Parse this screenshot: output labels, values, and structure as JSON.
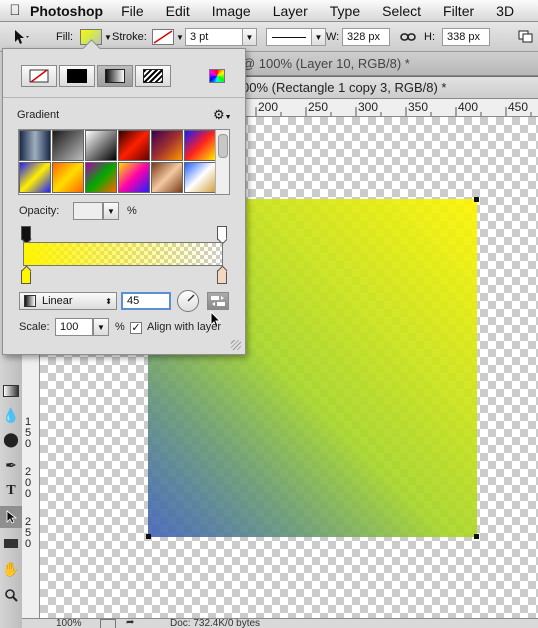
{
  "menubar": {
    "app_name": "Photoshop",
    "items": [
      "File",
      "Edit",
      "Image",
      "Layer",
      "Type",
      "Select",
      "Filter",
      "3D"
    ]
  },
  "options_bar": {
    "fill_label": "Fill:",
    "stroke_label": "Stroke:",
    "stroke_width": "3 pt",
    "width_label": "W:",
    "width_value": "328 px",
    "height_label": "H:",
    "height_value": "338 px"
  },
  "documents": {
    "tab_back": "@ 100% (Layer 10, RGB/8) *",
    "tab_front": "00% (Rectangle 1 copy 3, RGB/8) *"
  },
  "ruler": {
    "h_ticks": [
      "200",
      "250",
      "300",
      "350",
      "400",
      "450"
    ],
    "v_ticks": [
      "150",
      "200",
      "250"
    ]
  },
  "status": {
    "zoom": "100%",
    "doc": "Doc: 732.4K/0 bytes"
  },
  "gradient_panel": {
    "section_title": "Gradient",
    "opacity_label": "Opacity:",
    "opacity_unit": "%",
    "style_value": "Linear",
    "angle_value": "45",
    "scale_label": "Scale:",
    "scale_value": "100",
    "scale_unit": "%",
    "align_label": "Align with layer",
    "align_checked": true
  },
  "colors": {
    "gradient_start": "#5fbd4b",
    "gradient_end": "#fff600",
    "gradient_overlay": "#3f4fd7"
  }
}
